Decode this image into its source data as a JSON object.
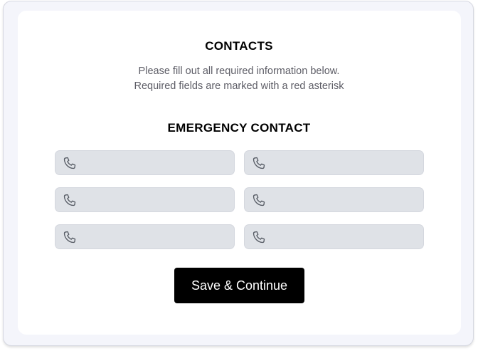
{
  "contacts": {
    "title": "CONTACTS",
    "instructions_line1": "Please fill out all required information below.",
    "instructions_line2": "Required fields are marked with a red asterisk"
  },
  "emergency_contact": {
    "title": "EMERGENCY CONTACT",
    "phone_fields": [
      {
        "icon": "phone-icon",
        "value": "",
        "placeholder": ""
      },
      {
        "icon": "phone-icon",
        "value": "",
        "placeholder": ""
      },
      {
        "icon": "phone-icon",
        "value": "",
        "placeholder": ""
      },
      {
        "icon": "phone-icon",
        "value": "",
        "placeholder": ""
      },
      {
        "icon": "phone-icon",
        "value": "",
        "placeholder": ""
      },
      {
        "icon": "phone-icon",
        "value": "",
        "placeholder": ""
      }
    ]
  },
  "actions": {
    "save_label": "Save & Continue"
  },
  "colors": {
    "button_bg": "#000000",
    "field_bg": "#dfe2e7",
    "page_bg": "#f4f5fb",
    "subtitle_text": "#5d5d66"
  }
}
